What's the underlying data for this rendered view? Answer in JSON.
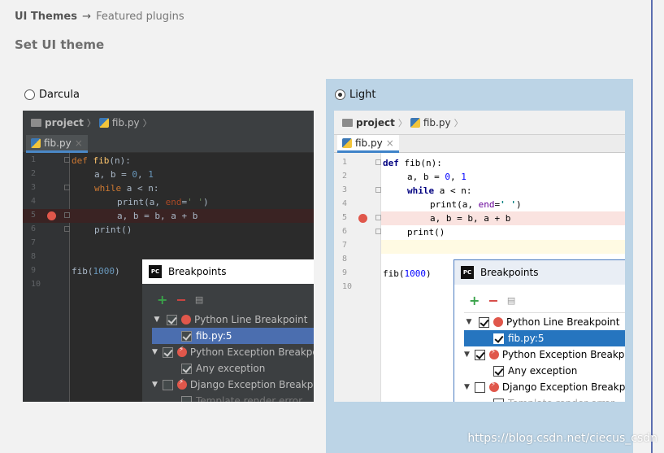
{
  "breadcrumb": {
    "root": "UI Themes",
    "separator": "→",
    "current": "Featured plugins"
  },
  "page_title": "Set UI theme",
  "themes": {
    "darcula": {
      "label": "Darcula",
      "selected": false
    },
    "light": {
      "label": "Light",
      "selected": true
    }
  },
  "preview": {
    "project": "project",
    "file": "fib.py",
    "tab_close": "×",
    "line_numbers": [
      "1",
      "2",
      "3",
      "4",
      "5",
      "6",
      "7",
      "8",
      "9",
      "10"
    ],
    "code": {
      "l1": {
        "kw": "def",
        "fn": "fib",
        "rest": "(n):"
      },
      "l2": {
        "a": "a, b = ",
        "n0": "0",
        "c": ", ",
        "n1": "1"
      },
      "l3": {
        "kw": "while",
        "rest": " a < n:"
      },
      "l4": {
        "a": "print(a, ",
        "param": "end",
        "eq": "=",
        "str": "' '",
        "close": ")"
      },
      "l5": "a, b = b, a + b",
      "l6": "print()",
      "l9": {
        "a": "fib(",
        "num": "1000",
        "close": ")"
      }
    }
  },
  "dialog": {
    "title": "Breakpoints",
    "pc_icon": "PC",
    "add": "+",
    "remove": "−",
    "manage": "▤",
    "items": {
      "python_line": "Python Line Breakpoint",
      "fib_line": "fib.py:5",
      "python_exception": "Python Exception Breakpoint",
      "any_exception": "Any exception",
      "django_exception": "Django Exception Breakpoint",
      "template_error": "Template render error"
    }
  },
  "watermark": "https://blog.csdn.net/ciecus_csdn",
  "colors": {
    "accent": "#4b6eaf",
    "light_select": "#2675bf",
    "light_panel": "#bcd4e6",
    "breakpoint": "#e0574b"
  }
}
